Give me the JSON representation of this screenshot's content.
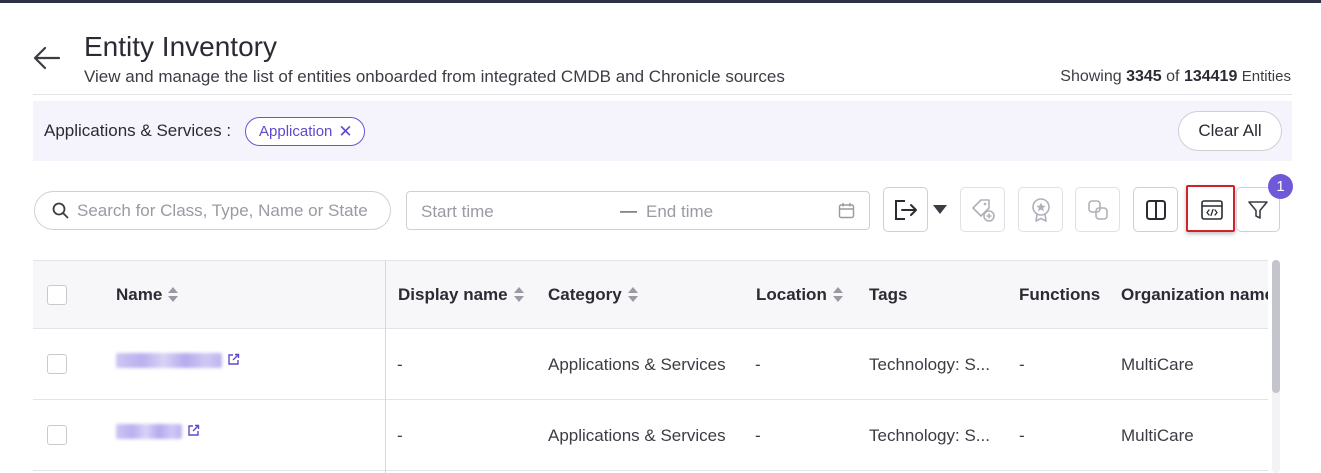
{
  "header": {
    "title": "Entity Inventory",
    "subtitle": "View and manage the list of entities onboarded from integrated CMDB and Chronicle sources",
    "showing_label": "Showing",
    "shown_count": "3345",
    "of_label": "of",
    "total_count": "134419",
    "entities_label": "Entities"
  },
  "filters": {
    "label": "Applications & Services :",
    "chips": [
      {
        "label": "Application",
        "remove_icon": "close-icon"
      }
    ],
    "clear_all": "Clear All"
  },
  "toolbar": {
    "search_placeholder": "Search for Class, Type, Name or State",
    "start_time_placeholder": "Start time",
    "range_separator": "—",
    "end_time_placeholder": "End time",
    "buttons": [
      "export-icon",
      "tag-add-icon",
      "badge-icon",
      "link-icon",
      "columns-icon",
      "code-view-icon",
      "filter-icon"
    ],
    "filter_badge_count": "1"
  },
  "table": {
    "columns": [
      "Name",
      "Display name",
      "Category",
      "Location",
      "Tags",
      "Functions",
      "Organization name"
    ],
    "rows": [
      {
        "name": "[redacted]",
        "display_name": "-",
        "category": "Applications & Services",
        "location": "-",
        "tags": "Technology: S...",
        "functions": "-",
        "organization": "MultiCare"
      },
      {
        "name": "[redacted]",
        "display_name": "-",
        "category": "Applications & Services",
        "location": "-",
        "tags": "Technology: S...",
        "functions": "-",
        "organization": "MultiCare"
      }
    ]
  },
  "colors": {
    "accent": "#6a55d8",
    "highlight": "#d0222a",
    "filter_bar_bg": "#f5f4fc"
  }
}
